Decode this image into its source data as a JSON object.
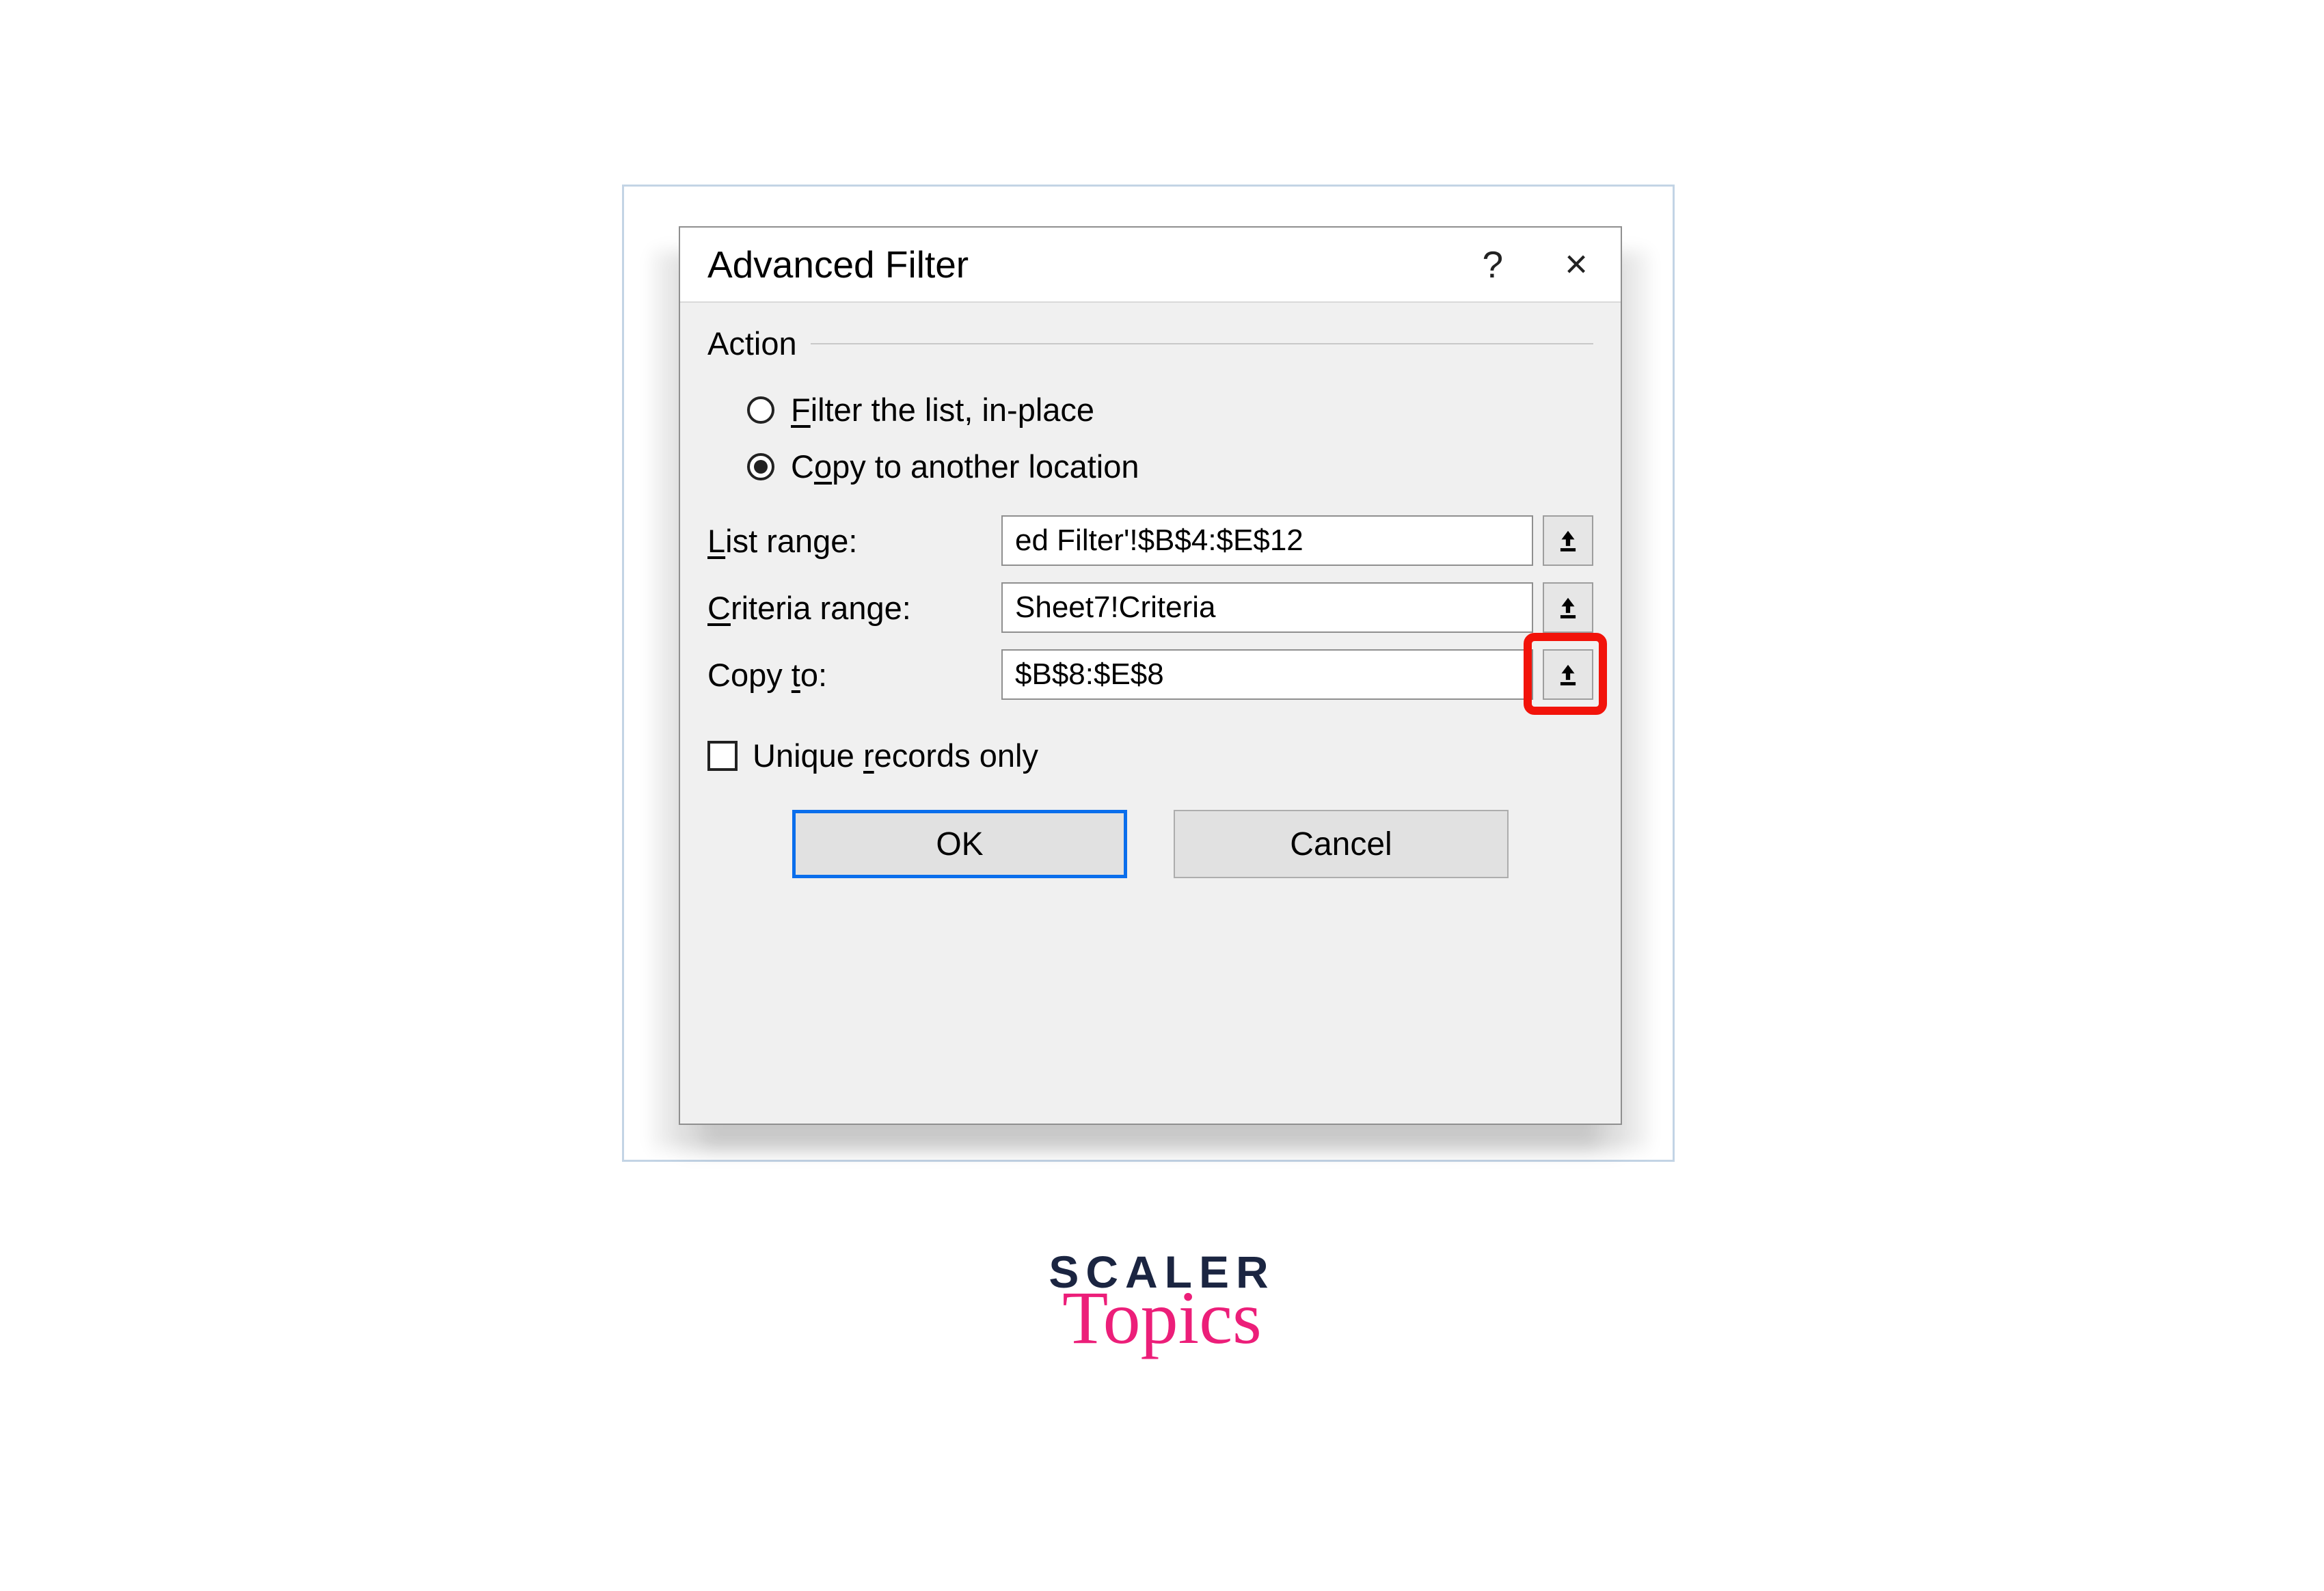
{
  "dialog": {
    "title": "Advanced Filter",
    "help": "?",
    "close": "×",
    "group_legend": "Action",
    "radios": [
      {
        "prefix": "",
        "underlined": "F",
        "suffix": "ilter the list, in-place",
        "selected": false
      },
      {
        "prefix": "C",
        "underlined": "o",
        "suffix": "py to another location",
        "selected": true
      }
    ],
    "fields": {
      "list_range": {
        "label_underlined": "L",
        "label_rest": "ist range:",
        "value": "ed Filter'!$B$4:$E$12"
      },
      "criteria": {
        "label_underlined": "C",
        "label_rest": "riteria range:",
        "value": "Sheet7!Criteria"
      },
      "copy_to": {
        "label_prefix": "Copy ",
        "label_underlined": "t",
        "label_suffix": "o:",
        "value": "$B$8:$E$8",
        "highlight": true
      }
    },
    "checkbox": {
      "prefix": "Unique ",
      "underlined": "r",
      "suffix": "ecords only",
      "checked": false
    },
    "buttons": {
      "ok": "OK",
      "cancel": "Cancel"
    }
  },
  "branding": {
    "top": "SCALER",
    "bottom": "Topics"
  }
}
